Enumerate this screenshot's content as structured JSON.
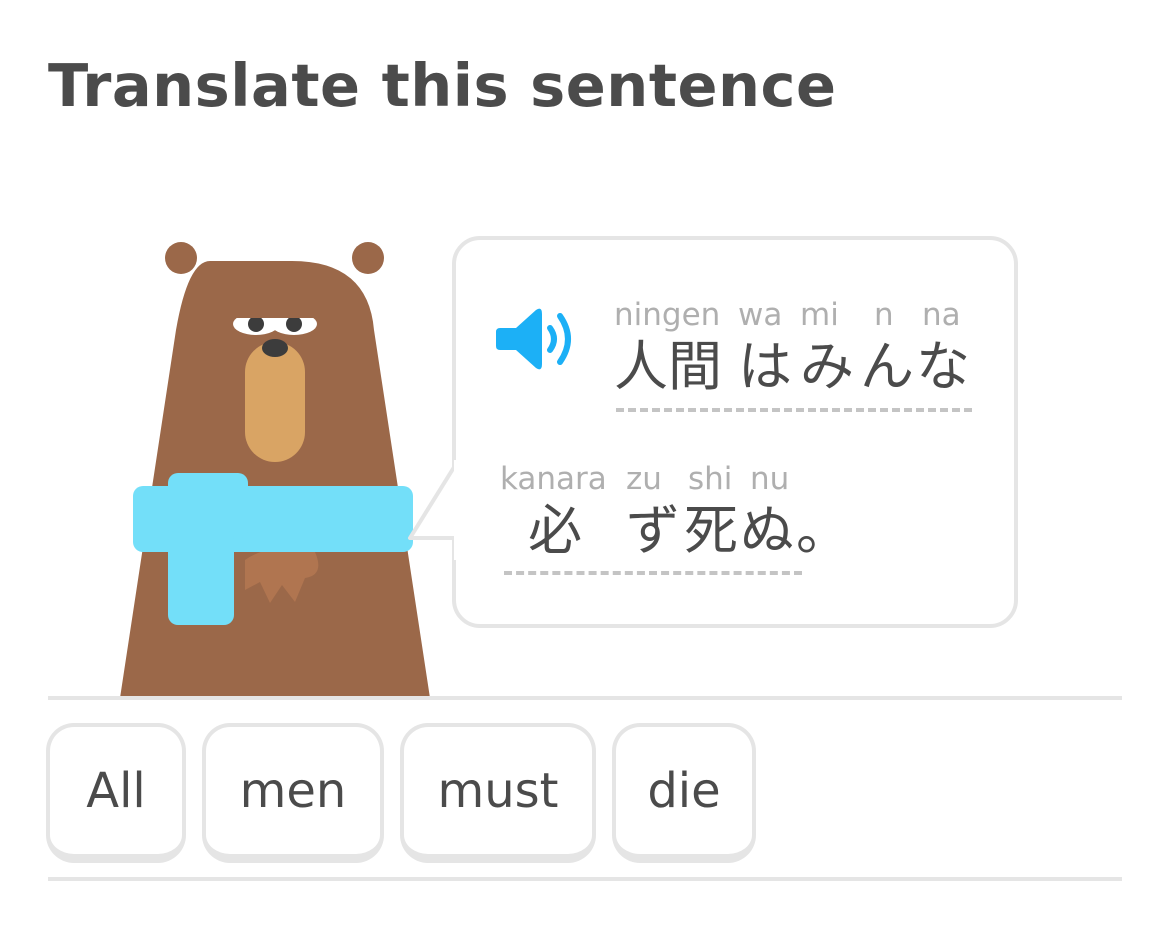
{
  "header": {
    "title": "Translate this sentence"
  },
  "prompt": {
    "audio_icon": "speaker-icon",
    "line1": [
      {
        "reading": "ningen",
        "text": "人間"
      },
      {
        "reading": "wa",
        "text": "は"
      },
      {
        "reading": "mi",
        "text": "み"
      },
      {
        "reading": "n",
        "text": "ん"
      },
      {
        "reading": "na",
        "text": "な"
      }
    ],
    "line2": [
      {
        "reading": "kanara",
        "text": "必"
      },
      {
        "reading": "zu",
        "text": "ず"
      },
      {
        "reading": "shi",
        "text": "死"
      },
      {
        "reading": "nu",
        "text": "ぬ"
      },
      {
        "reading": "",
        "text": "。"
      }
    ]
  },
  "word_bank": [
    "All",
    "men",
    "must",
    "die"
  ],
  "colors": {
    "text": "#4b4b4b",
    "reading": "#afafaf",
    "border": "#e5e5e5",
    "speaker": "#1cb0f6",
    "bear_fur": "#9b6849",
    "bear_muzzle": "#d9a464",
    "scarf": "#73dff9"
  }
}
